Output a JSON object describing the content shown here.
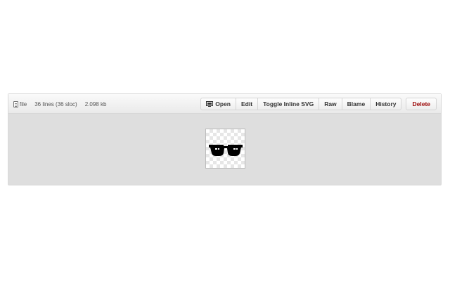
{
  "file_header": {
    "file_label": "file",
    "lines_info": "36 lines (36 sloc)",
    "size_info": "2.098 kb"
  },
  "actions": {
    "open_label": "Open",
    "edit_label": "Edit",
    "toggle_svg_label": "Toggle Inline SVG",
    "raw_label": "Raw",
    "blame_label": "Blame",
    "history_label": "History",
    "delete_label": "Delete"
  },
  "icons": {
    "file": "file-icon",
    "open": "open-in-desktop-icon",
    "preview": "sunglasses-icon"
  },
  "colors": {
    "delete_text": "#990000",
    "preview_background": "#dedede"
  }
}
